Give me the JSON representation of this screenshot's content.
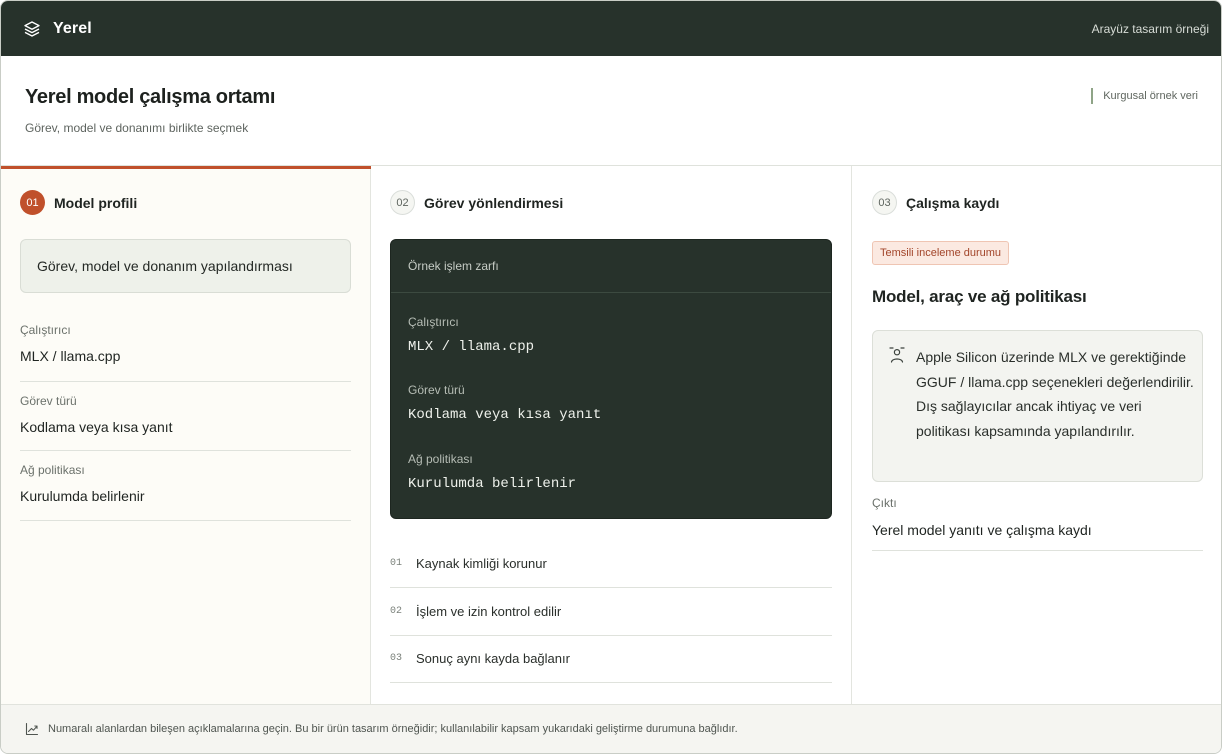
{
  "app": {
    "name": "Yerel",
    "logo_icon": "layers-icon",
    "top_right_label": "Arayüz tasarım örneği"
  },
  "header": {
    "title": "Yerel model çalışma ortamı",
    "subtitle": "Görev, model ve donanımı birlikte seçmek",
    "sample_tag": "Kurgusal örnek veri"
  },
  "accent_color": "#c0502b",
  "sections": {
    "profile": {
      "number": "01",
      "title": "Model profili",
      "config_box": "Görev, model ve donanım yapılandırması",
      "fields": [
        {
          "label": "Çalıştırıcı",
          "value": "MLX / llama.cpp"
        },
        {
          "label": "Görev türü",
          "value": "Kodlama veya kısa yanıt"
        },
        {
          "label": "Ağ politikası",
          "value": "Kurulumda belirlenir"
        }
      ]
    },
    "routing": {
      "number": "02",
      "title": "Görev yönlendirmesi",
      "card_title": "Örnek işlem zarfı",
      "card_items": [
        {
          "label": "Çalıştırıcı",
          "value": "MLX / llama.cpp"
        },
        {
          "label": "Görev türü",
          "value": "Kodlama veya kısa yanıt"
        },
        {
          "label": "Ağ politikası",
          "value": "Kurulumda belirlenir"
        }
      ],
      "steps": [
        {
          "num": "01",
          "text": "Kaynak kimliği korunur"
        },
        {
          "num": "02",
          "text": "İşlem ve izin kontrol edilir"
        },
        {
          "num": "03",
          "text": "Sonuç aynı kayda bağlanır"
        }
      ]
    },
    "log": {
      "number": "03",
      "title": "Çalışma kaydı",
      "badge": "Temsili inceleme durumu",
      "policy_title": "Model, araç ve ağ politikası",
      "note_icon": "person-icon",
      "note": "Apple Silicon üzerinde MLX ve gerektiğinde GGUF / llama.cpp seçenekleri değerlendirilir. Dış sağlayıcılar ancak ihtiyaç ve veri politikası kapsamında yapılandırılır.",
      "output_label": "Çıktı",
      "output_value": "Yerel model yanıtı ve çalışma kaydı"
    }
  },
  "footer": {
    "icon": "trend-chart-icon",
    "text": "Numaralı alanlardan bileşen açıklamalarına geçin. Bu bir ürün tasarım örneğidir; kullanılabilir kapsam yukarıdaki geliştirme durumuna bağlıdır."
  }
}
